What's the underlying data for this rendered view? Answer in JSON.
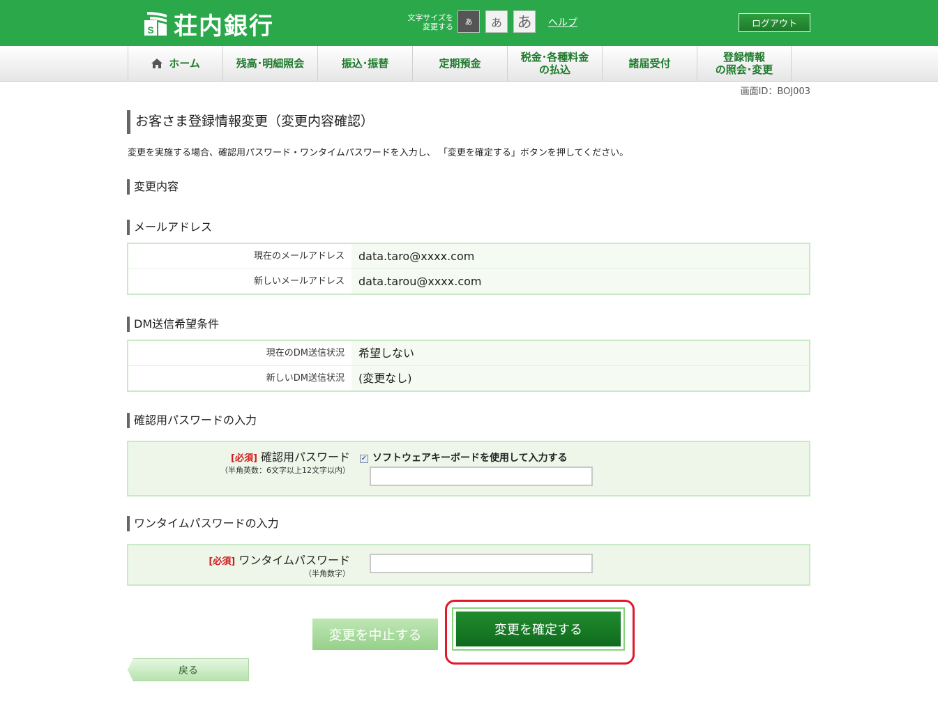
{
  "header": {
    "bank_name": "荘内銀行",
    "font_size_label_1": "文字サイズを",
    "font_size_label_2": "変更する",
    "font_size_small": "あ",
    "font_size_mid": "あ",
    "font_size_large": "あ",
    "help": "ヘルプ",
    "logout": "ログアウト",
    "brand_color": "#2aa84a"
  },
  "nav": {
    "items": [
      {
        "label": "ホーム",
        "icon": "home-icon"
      },
      {
        "label": "残高･明細照会"
      },
      {
        "label": "振込･振替"
      },
      {
        "label": "定期預金"
      },
      {
        "label_1": "税金･各種料金",
        "label_2": "の払込"
      },
      {
        "label": "諸届受付"
      },
      {
        "label_1": "登録情報",
        "label_2": "の照会･変更"
      }
    ]
  },
  "screen_id": "画面ID：BOJ003",
  "page": {
    "title": "お客さま登録情報変更（変更内容確認）",
    "description": "変更を実施する場合、確認用パスワード・ワンタイムパスワードを入力し、 「変更を確定する」ボタンを押してください。",
    "section_changes": "変更内容"
  },
  "email": {
    "heading": "メールアドレス",
    "current_label": "現在のメールアドレス",
    "current_value": "data.taro@xxxx.com",
    "new_label": "新しいメールアドレス",
    "new_value": "data.tarou@xxxx.com"
  },
  "dm": {
    "heading": "DM送信希望条件",
    "current_label": "現在のDM送信状況",
    "current_value": "希望しない",
    "new_label": "新しいDM送信状況",
    "new_value": "(変更なし)"
  },
  "confirm_pw": {
    "heading": "確認用パスワードの入力",
    "required": "[必須]",
    "label": "確認用パスワード",
    "note": "（半角英数：6文字以上12文字以内）",
    "checkbox_label": "ソフトウェアキーボードを使用して入力する",
    "checked": true,
    "value": ""
  },
  "otp": {
    "heading": "ワンタイムパスワードの入力",
    "required": "[必須]",
    "label": "ワンタイムパスワード",
    "note": "（半角数字）",
    "value": ""
  },
  "buttons": {
    "cancel": "変更を中止する",
    "confirm": "変更を確定する",
    "back": "戻る"
  }
}
